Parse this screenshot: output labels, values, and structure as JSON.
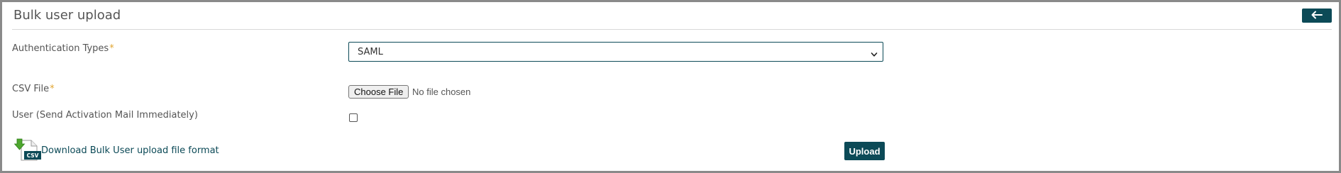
{
  "page": {
    "title": "Bulk user upload"
  },
  "header": {
    "back_icon": "arrow-left-icon"
  },
  "form": {
    "auth_types": {
      "label": "Authentication Types",
      "required_marker": "*",
      "selected": "SAML"
    },
    "csv_file": {
      "label": "CSV File",
      "required_marker": "*",
      "button_label": "Choose File",
      "status": "No file chosen"
    },
    "send_activation": {
      "label": "User (Send Activation Mail Immediately)",
      "checked": false
    }
  },
  "download": {
    "icon": "csv-download-icon",
    "icon_text": "CSV",
    "link_text": "Download Bulk User upload file format"
  },
  "actions": {
    "upload_label": "Upload"
  },
  "colors": {
    "accent": "#0c4a57",
    "required": "#e2a531",
    "text": "#555555"
  }
}
